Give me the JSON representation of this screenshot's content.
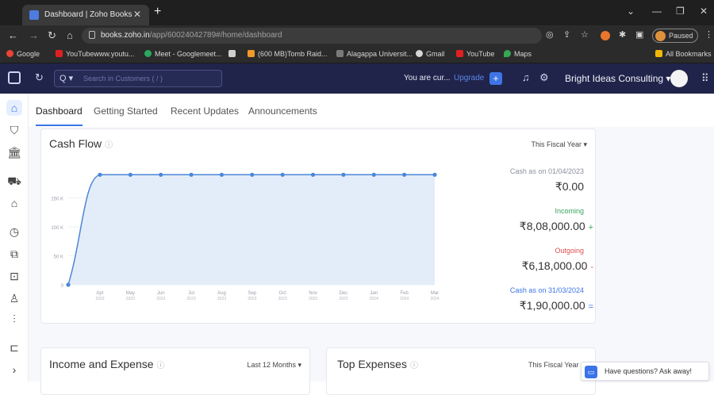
{
  "browser": {
    "tab_title": "Dashboard | Zoho Books",
    "url_host": "books.zoho.in",
    "url_path": "/app/60024042789#/home/dashboard",
    "paused_label": "Paused",
    "bookmarks": [
      "Google",
      "YouTubewww.youtu...",
      "Meet - Googlemeet...",
      "(600 MB)Tomb Raid...",
      "Alagappa Universit...",
      "Gmail",
      "YouTube",
      "Maps"
    ],
    "all_bookmarks": "All Bookmarks"
  },
  "header": {
    "search_prefix": "Q ▾",
    "search_placeholder": "Search in Customers ( / )",
    "notice": "You are cur...",
    "upgrade": "Upgrade",
    "org_name": "Bright Ideas Consulting ▾"
  },
  "tabs": [
    "Dashboard",
    "Getting Started",
    "Recent Updates",
    "Announcements"
  ],
  "cash_flow": {
    "title": "Cash Flow",
    "filter": "This Fiscal Year ▾",
    "opening_label": "Cash as on 01/04/2023",
    "opening_amount": "₹0.00",
    "incoming_label": "Incoming",
    "incoming_amount": "₹8,08,000.00",
    "incoming_sign": "+",
    "outgoing_label": "Outgoing",
    "outgoing_amount": "₹6,18,000.00",
    "outgoing_sign": "-",
    "closing_label": "Cash as on 31/03/2024",
    "closing_amount": "₹1,90,000.00",
    "closing_sign": "="
  },
  "chart_data": {
    "type": "area",
    "y_ticks": [
      "0",
      "50 K",
      "100 K",
      "150 K"
    ],
    "ylim": [
      0,
      200000
    ],
    "x_labels": [
      {
        "m": "Apr",
        "y": "2023"
      },
      {
        "m": "May",
        "y": "2023"
      },
      {
        "m": "Jun",
        "y": "2023"
      },
      {
        "m": "Jul",
        "y": "2023"
      },
      {
        "m": "Aug",
        "y": "2023"
      },
      {
        "m": "Sep",
        "y": "2023"
      },
      {
        "m": "Oct",
        "y": "2023"
      },
      {
        "m": "Nov",
        "y": "2023"
      },
      {
        "m": "Dec",
        "y": "2023"
      },
      {
        "m": "Jan",
        "y": "2024"
      },
      {
        "m": "Feb",
        "y": "2024"
      },
      {
        "m": "Mar",
        "y": "2024"
      }
    ],
    "start_value": 0,
    "values": [
      190000,
      190000,
      190000,
      190000,
      190000,
      190000,
      190000,
      190000,
      190000,
      190000,
      190000,
      190000
    ],
    "colors": {
      "line": "#4a86d6",
      "fill": "#e3edf9"
    }
  },
  "income_expense": {
    "title": "Income and Expense",
    "filter": "Last 12 Months ▾"
  },
  "top_expenses": {
    "title": "Top Expenses",
    "filter": "This Fiscal Year"
  },
  "chat": {
    "label": "Have questions? Ask away!"
  }
}
